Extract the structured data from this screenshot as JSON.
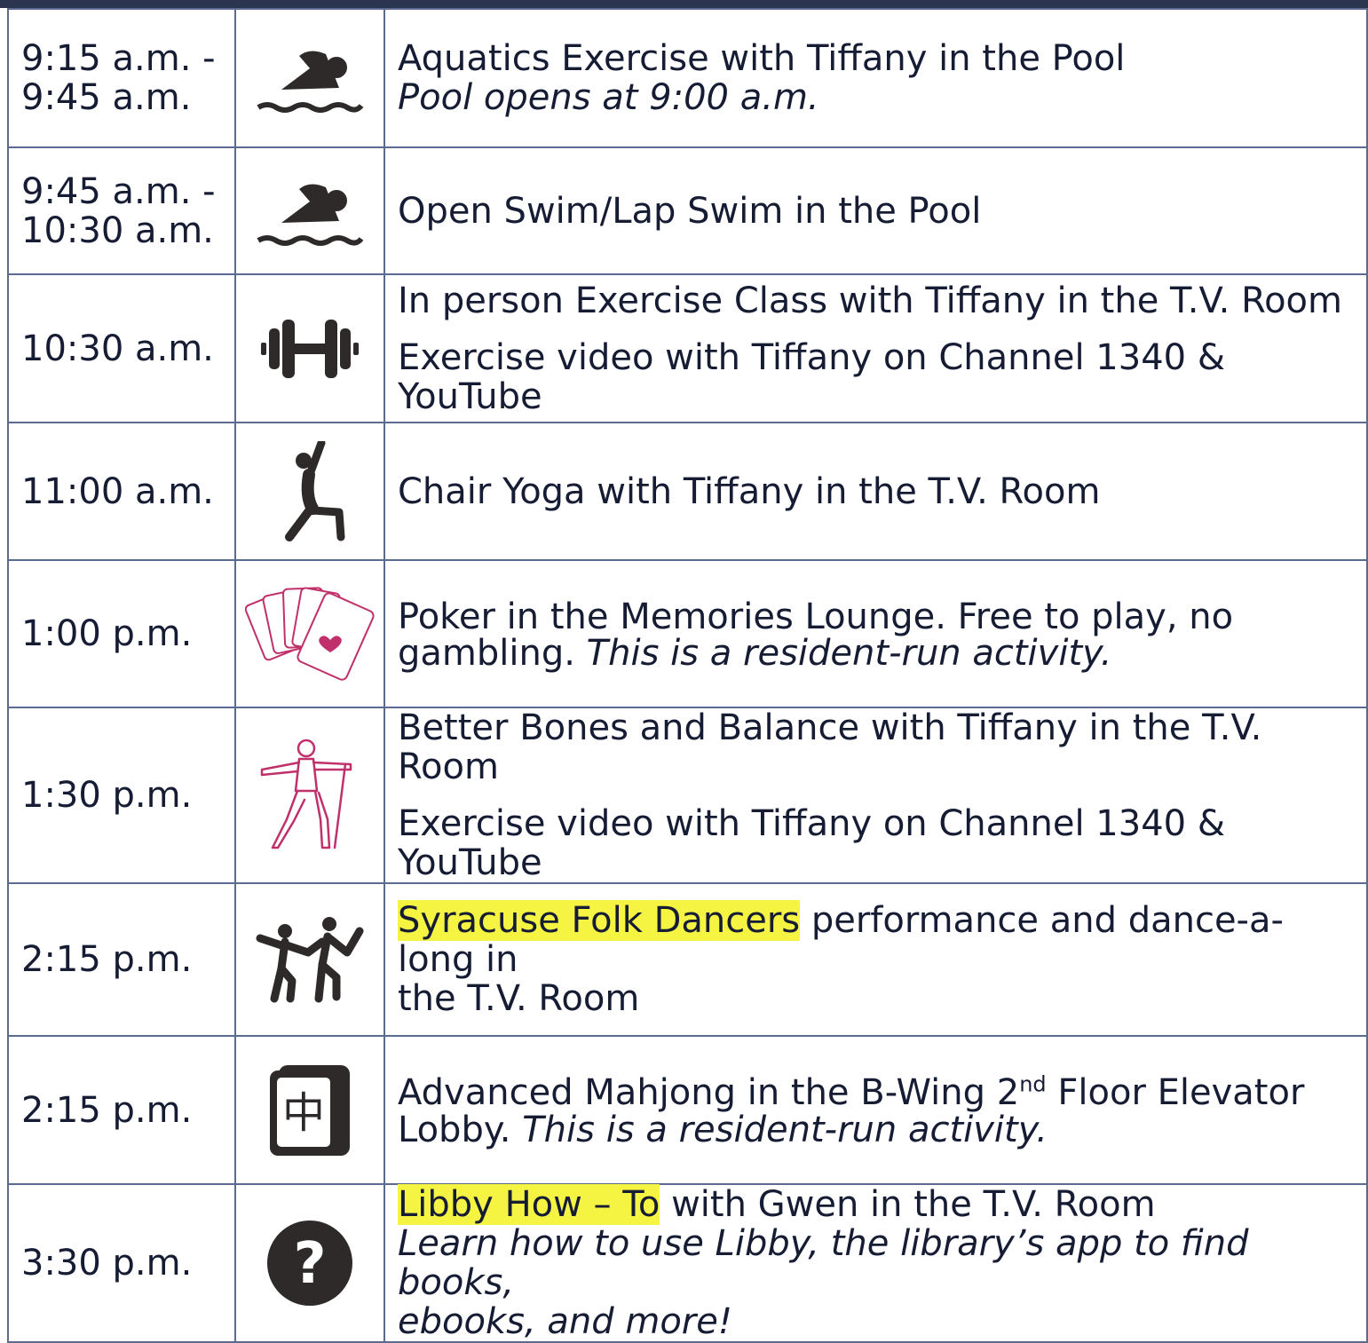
{
  "rows": [
    {
      "time_l1": "9:15 a.m. -",
      "time_l2": "9:45 a.m.",
      "icon": "swimmer-icon",
      "desc_l1": "Aquatics Exercise with Tiffany in the Pool",
      "desc_l2": "Pool opens at 9:00 a.m."
    },
    {
      "time_l1": "9:45 a.m. -",
      "time_l2": "10:30 a.m.",
      "icon": "swimmer-icon",
      "desc_l1": "Open Swim/Lap Swim in the Pool"
    },
    {
      "time_l1": "10:30 a.m.",
      "icon": "dumbbell-icon",
      "desc_l1": "In person Exercise Class with Tiffany in the T.V. Room",
      "desc_l2": "Exercise video with Tiffany on Channel 1340 & YouTube"
    },
    {
      "time_l1": "11:00 a.m.",
      "icon": "yoga-pose-icon",
      "desc_l1": "Chair Yoga with Tiffany in the T.V. Room"
    },
    {
      "time_l1": "1:00 p.m.",
      "icon": "playing-cards-icon",
      "desc_l1": "Poker in the Memories Lounge. Free to play, no",
      "desc_l2a": "gambling.",
      "desc_l2b": "This is a resident-run activity."
    },
    {
      "time_l1": "1:30 p.m.",
      "icon": "balance-figure-icon",
      "desc_l1": "Better Bones and Balance with Tiffany in the T.V. Room",
      "desc_l2": "Exercise video with Tiffany on Channel 1340 & YouTube"
    },
    {
      "time_l1": "2:15 p.m.",
      "icon": "dancers-icon",
      "desc_hl": "Syracuse Folk Dancers",
      "desc_l1": "performance and dance-a-long in",
      "desc_l2": "the T.V. Room"
    },
    {
      "time_l1": "2:15 p.m.",
      "icon": "mahjong-tile-icon",
      "desc_l1a": "Advanced Mahjong in the B-Wing 2",
      "desc_sup": "nd",
      "desc_l1b": "Floor Elevator",
      "desc_l2a": "Lobby.",
      "desc_l2b": "This is a resident-run activity."
    },
    {
      "time_l1": "3:30 p.m.",
      "icon": "question-mark-icon",
      "desc_hl": "Libby How – To",
      "desc_l1": "with Gwen in the T.V. Room",
      "desc_l2": "Learn how to use Libby, the library’s app to find books,",
      "desc_l3": "ebooks, and more!"
    }
  ],
  "colors": {
    "text": "#161c33",
    "border": "#5a6b8f",
    "highlight": "#f6f442",
    "icon_dark": "#2e2a2a",
    "icon_pink": "#c0306a"
  }
}
